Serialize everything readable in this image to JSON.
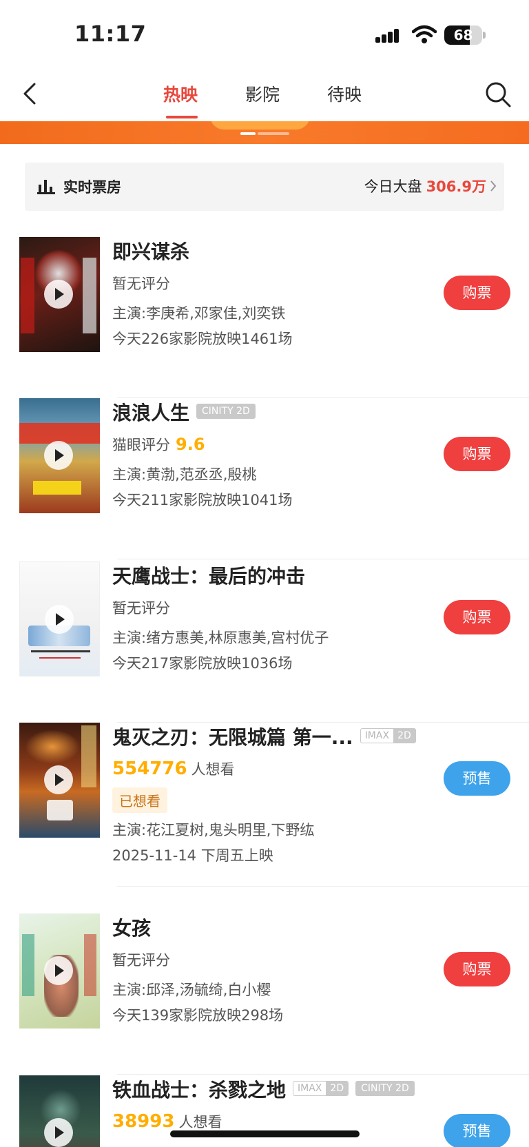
{
  "status_bar": {
    "time": "11:17",
    "battery": "68"
  },
  "nav": {
    "tabs": [
      {
        "label": "热映"
      },
      {
        "label": "影院"
      },
      {
        "label": "待映"
      }
    ]
  },
  "box_office": {
    "title": "实时票房",
    "label": "今日大盘",
    "value": "306.9万"
  },
  "movies": [
    {
      "title": "即兴谋杀",
      "rating_text": "暂无评分",
      "cast": "主演:李庚希,邓家佳,刘奕铁",
      "showing": "今天226家影院放映1461场",
      "button": "购票"
    },
    {
      "title": "浪浪人生",
      "tag": "CINITY 2D",
      "rating_label": "猫眼评分",
      "score": "9.6",
      "cast": "主演:黄渤,范丞丞,殷桃",
      "showing": "今天211家影院放映1041场",
      "button": "购票"
    },
    {
      "title": "天鹰战士：最后的冲击",
      "rating_text": "暂无评分",
      "cast": "主演:绪方惠美,林原惠美,宫村优子",
      "showing": "今天217家影院放映1036场",
      "button": "购票"
    },
    {
      "title": "鬼灭之刃：无限城篇 第一...",
      "tag_imax": "IMAX",
      "tag_2d": "2D",
      "wish_count": "554776",
      "wish_label": "人想看",
      "badge": "已想看",
      "cast": "主演:花江夏树,鬼头明里,下野纮",
      "release": "2025-11-14 下周五上映",
      "button": "预售"
    },
    {
      "title": "女孩",
      "rating_text": "暂无评分",
      "cast": "主演:邱泽,汤毓绮,白小樱",
      "showing": "今天139家影院放映298场",
      "button": "购票"
    },
    {
      "title": "铁血战士：杀戮之地",
      "tag_imax": "IMAX",
      "tag_2d": "2D",
      "tag": "CINITY 2D",
      "wish_count": "38993",
      "wish_label": "人想看",
      "button": "预售"
    }
  ],
  "colors": {
    "accent": "#e8483c",
    "buy": "#ef3f3f",
    "presale": "#3ea3ea",
    "score": "#ffae00"
  }
}
